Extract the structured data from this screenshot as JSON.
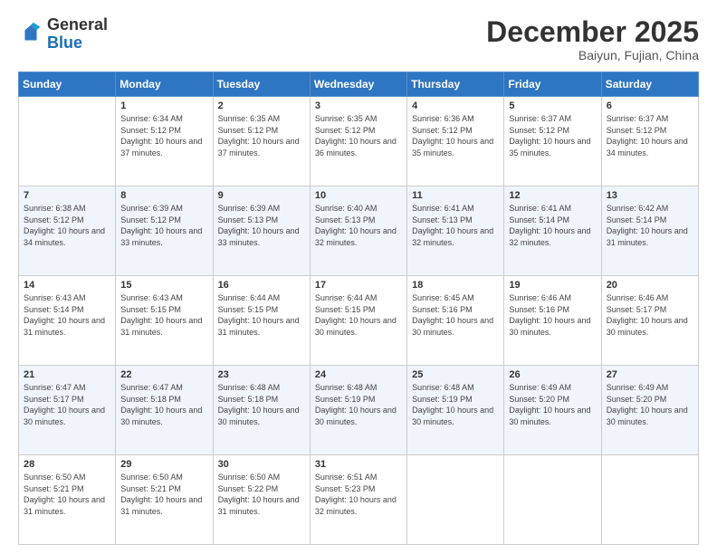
{
  "logo": {
    "general": "General",
    "blue": "Blue"
  },
  "header": {
    "month": "December 2025",
    "location": "Baiyun, Fujian, China"
  },
  "weekdays": [
    "Sunday",
    "Monday",
    "Tuesday",
    "Wednesday",
    "Thursday",
    "Friday",
    "Saturday"
  ],
  "weeks": [
    [
      {
        "day": "",
        "sunrise": "",
        "sunset": "",
        "daylight": ""
      },
      {
        "day": "1",
        "sunrise": "Sunrise: 6:34 AM",
        "sunset": "Sunset: 5:12 PM",
        "daylight": "Daylight: 10 hours and 37 minutes."
      },
      {
        "day": "2",
        "sunrise": "Sunrise: 6:35 AM",
        "sunset": "Sunset: 5:12 PM",
        "daylight": "Daylight: 10 hours and 37 minutes."
      },
      {
        "day": "3",
        "sunrise": "Sunrise: 6:35 AM",
        "sunset": "Sunset: 5:12 PM",
        "daylight": "Daylight: 10 hours and 36 minutes."
      },
      {
        "day": "4",
        "sunrise": "Sunrise: 6:36 AM",
        "sunset": "Sunset: 5:12 PM",
        "daylight": "Daylight: 10 hours and 35 minutes."
      },
      {
        "day": "5",
        "sunrise": "Sunrise: 6:37 AM",
        "sunset": "Sunset: 5:12 PM",
        "daylight": "Daylight: 10 hours and 35 minutes."
      },
      {
        "day": "6",
        "sunrise": "Sunrise: 6:37 AM",
        "sunset": "Sunset: 5:12 PM",
        "daylight": "Daylight: 10 hours and 34 minutes."
      }
    ],
    [
      {
        "day": "7",
        "sunrise": "Sunrise: 6:38 AM",
        "sunset": "Sunset: 5:12 PM",
        "daylight": "Daylight: 10 hours and 34 minutes."
      },
      {
        "day": "8",
        "sunrise": "Sunrise: 6:39 AM",
        "sunset": "Sunset: 5:12 PM",
        "daylight": "Daylight: 10 hours and 33 minutes."
      },
      {
        "day": "9",
        "sunrise": "Sunrise: 6:39 AM",
        "sunset": "Sunset: 5:13 PM",
        "daylight": "Daylight: 10 hours and 33 minutes."
      },
      {
        "day": "10",
        "sunrise": "Sunrise: 6:40 AM",
        "sunset": "Sunset: 5:13 PM",
        "daylight": "Daylight: 10 hours and 32 minutes."
      },
      {
        "day": "11",
        "sunrise": "Sunrise: 6:41 AM",
        "sunset": "Sunset: 5:13 PM",
        "daylight": "Daylight: 10 hours and 32 minutes."
      },
      {
        "day": "12",
        "sunrise": "Sunrise: 6:41 AM",
        "sunset": "Sunset: 5:14 PM",
        "daylight": "Daylight: 10 hours and 32 minutes."
      },
      {
        "day": "13",
        "sunrise": "Sunrise: 6:42 AM",
        "sunset": "Sunset: 5:14 PM",
        "daylight": "Daylight: 10 hours and 31 minutes."
      }
    ],
    [
      {
        "day": "14",
        "sunrise": "Sunrise: 6:43 AM",
        "sunset": "Sunset: 5:14 PM",
        "daylight": "Daylight: 10 hours and 31 minutes."
      },
      {
        "day": "15",
        "sunrise": "Sunrise: 6:43 AM",
        "sunset": "Sunset: 5:15 PM",
        "daylight": "Daylight: 10 hours and 31 minutes."
      },
      {
        "day": "16",
        "sunrise": "Sunrise: 6:44 AM",
        "sunset": "Sunset: 5:15 PM",
        "daylight": "Daylight: 10 hours and 31 minutes."
      },
      {
        "day": "17",
        "sunrise": "Sunrise: 6:44 AM",
        "sunset": "Sunset: 5:15 PM",
        "daylight": "Daylight: 10 hours and 30 minutes."
      },
      {
        "day": "18",
        "sunrise": "Sunrise: 6:45 AM",
        "sunset": "Sunset: 5:16 PM",
        "daylight": "Daylight: 10 hours and 30 minutes."
      },
      {
        "day": "19",
        "sunrise": "Sunrise: 6:46 AM",
        "sunset": "Sunset: 5:16 PM",
        "daylight": "Daylight: 10 hours and 30 minutes."
      },
      {
        "day": "20",
        "sunrise": "Sunrise: 6:46 AM",
        "sunset": "Sunset: 5:17 PM",
        "daylight": "Daylight: 10 hours and 30 minutes."
      }
    ],
    [
      {
        "day": "21",
        "sunrise": "Sunrise: 6:47 AM",
        "sunset": "Sunset: 5:17 PM",
        "daylight": "Daylight: 10 hours and 30 minutes."
      },
      {
        "day": "22",
        "sunrise": "Sunrise: 6:47 AM",
        "sunset": "Sunset: 5:18 PM",
        "daylight": "Daylight: 10 hours and 30 minutes."
      },
      {
        "day": "23",
        "sunrise": "Sunrise: 6:48 AM",
        "sunset": "Sunset: 5:18 PM",
        "daylight": "Daylight: 10 hours and 30 minutes."
      },
      {
        "day": "24",
        "sunrise": "Sunrise: 6:48 AM",
        "sunset": "Sunset: 5:19 PM",
        "daylight": "Daylight: 10 hours and 30 minutes."
      },
      {
        "day": "25",
        "sunrise": "Sunrise: 6:48 AM",
        "sunset": "Sunset: 5:19 PM",
        "daylight": "Daylight: 10 hours and 30 minutes."
      },
      {
        "day": "26",
        "sunrise": "Sunrise: 6:49 AM",
        "sunset": "Sunset: 5:20 PM",
        "daylight": "Daylight: 10 hours and 30 minutes."
      },
      {
        "day": "27",
        "sunrise": "Sunrise: 6:49 AM",
        "sunset": "Sunset: 5:20 PM",
        "daylight": "Daylight: 10 hours and 30 minutes."
      }
    ],
    [
      {
        "day": "28",
        "sunrise": "Sunrise: 6:50 AM",
        "sunset": "Sunset: 5:21 PM",
        "daylight": "Daylight: 10 hours and 31 minutes."
      },
      {
        "day": "29",
        "sunrise": "Sunrise: 6:50 AM",
        "sunset": "Sunset: 5:21 PM",
        "daylight": "Daylight: 10 hours and 31 minutes."
      },
      {
        "day": "30",
        "sunrise": "Sunrise: 6:50 AM",
        "sunset": "Sunset: 5:22 PM",
        "daylight": "Daylight: 10 hours and 31 minutes."
      },
      {
        "day": "31",
        "sunrise": "Sunrise: 6:51 AM",
        "sunset": "Sunset: 5:23 PM",
        "daylight": "Daylight: 10 hours and 32 minutes."
      },
      {
        "day": "",
        "sunrise": "",
        "sunset": "",
        "daylight": ""
      },
      {
        "day": "",
        "sunrise": "",
        "sunset": "",
        "daylight": ""
      },
      {
        "day": "",
        "sunrise": "",
        "sunset": "",
        "daylight": ""
      }
    ]
  ]
}
